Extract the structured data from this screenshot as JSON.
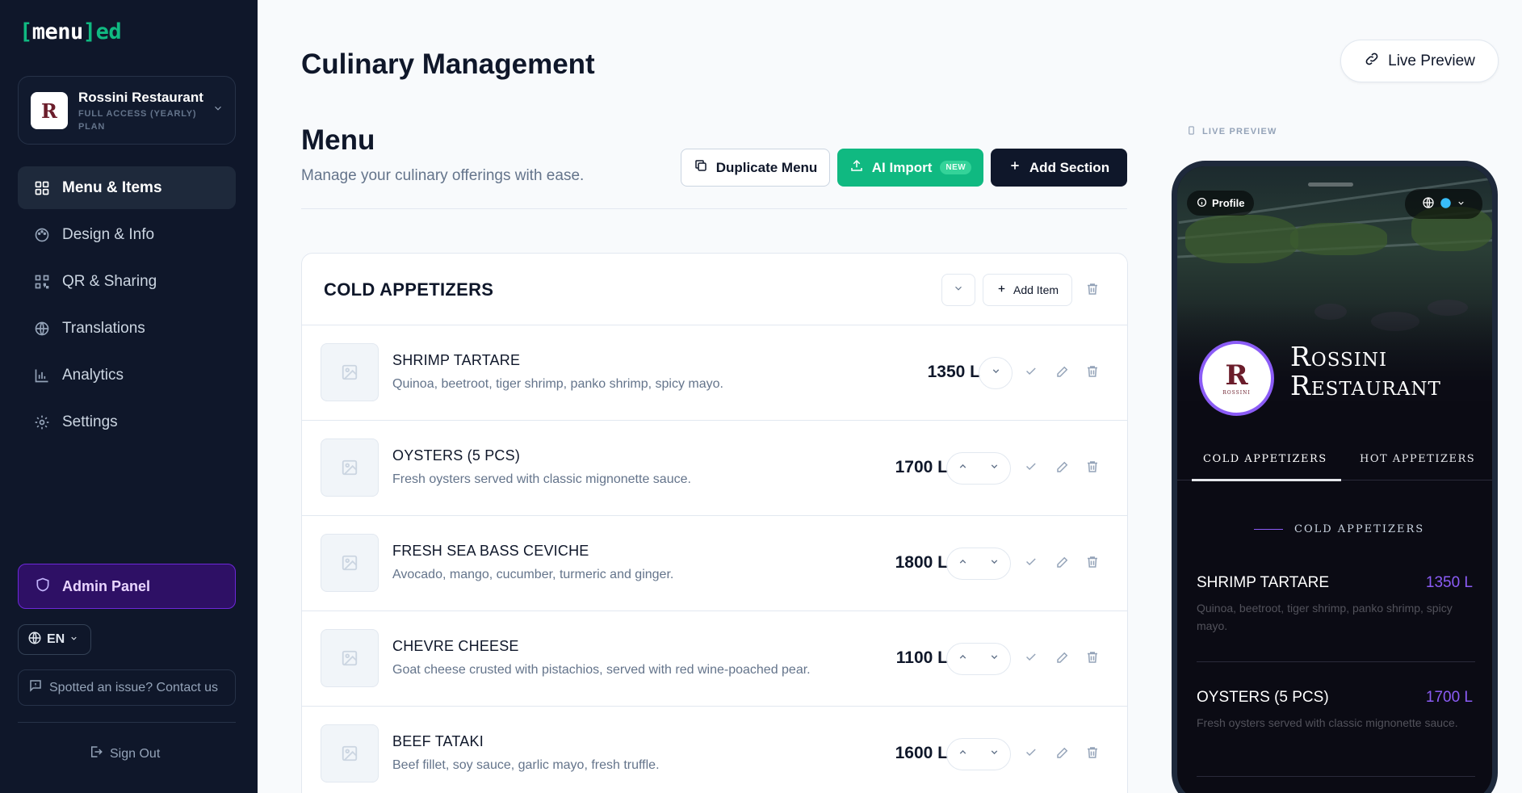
{
  "brand": {
    "bracket_open": "[",
    "word": "menu",
    "bracket_close": "]",
    "suffix": "ed"
  },
  "restaurant": {
    "name": "Rossini Restaurant",
    "plan": "FULL ACCESS (YEARLY) PLAN",
    "logo_letter": "R"
  },
  "nav": {
    "items": [
      {
        "label": "Menu & Items",
        "icon": "grid-icon",
        "active": true
      },
      {
        "label": "Design & Info",
        "icon": "palette-icon"
      },
      {
        "label": "QR & Sharing",
        "icon": "qr-icon"
      },
      {
        "label": "Translations",
        "icon": "globe-icon"
      },
      {
        "label": "Analytics",
        "icon": "bar-chart-icon"
      },
      {
        "label": "Settings",
        "icon": "gear-icon"
      }
    ]
  },
  "sidebar": {
    "admin_label": "Admin Panel",
    "lang": "EN",
    "issue_label": "Spotted an issue? Contact us",
    "signout_label": "Sign Out"
  },
  "header": {
    "title": "Culinary Management",
    "live_preview": "Live Preview"
  },
  "menu": {
    "heading": "Menu",
    "subtitle": "Manage your culinary offerings with ease.",
    "duplicate_label": "Duplicate Menu",
    "ai_import_label": "AI Import",
    "ai_badge": "NEW",
    "add_section_label": "Add Section"
  },
  "section": {
    "title": "COLD APPETIZERS",
    "add_item_label": "Add Item",
    "items": [
      {
        "name": "SHRIMP TARTARE",
        "desc": "Quinoa, beetroot, tiger shrimp, panko shrimp, spicy mayo.",
        "price": "1350 L"
      },
      {
        "name": "OYSTERS (5 PCS)",
        "desc": "Fresh oysters served with classic mignonette sauce.",
        "price": "1700 L"
      },
      {
        "name": "FRESH SEA BASS CEVICHE",
        "desc": "Avocado, mango, cucumber, turmeric and ginger.",
        "price": "1800 L"
      },
      {
        "name": "CHEVRE CHEESE",
        "desc": "Goat cheese crusted with pistachios, served with red wine-poached pear.",
        "price": "1100 L"
      },
      {
        "name": "BEEF TATAKI",
        "desc": "Beef fillet, soy sauce, garlic mayo, fresh truffle.",
        "price": "1600 L"
      }
    ]
  },
  "preview": {
    "label": "LIVE PREVIEW",
    "profile_chip": "Profile",
    "name_line1": "Rossini",
    "name_line2": "Restaurant",
    "logo_letter": "R",
    "logo_sub": "ROSSINI",
    "tabs": [
      "COLD APPETIZERS",
      "HOT APPETIZERS"
    ],
    "section_title": "COLD APPETIZERS",
    "items": [
      {
        "name": "SHRIMP TARTARE",
        "price": "1350 L",
        "desc": "Quinoa, beetroot, tiger shrimp, panko shrimp, spicy mayo."
      },
      {
        "name": "OYSTERS (5 PCS)",
        "price": "1700 L",
        "desc": "Fresh oysters served with classic mignonette sauce."
      }
    ]
  },
  "colors": {
    "accent_green": "#10b981",
    "accent_purple": "#8b5cf6",
    "sidebar_bg": "#0f172a"
  }
}
